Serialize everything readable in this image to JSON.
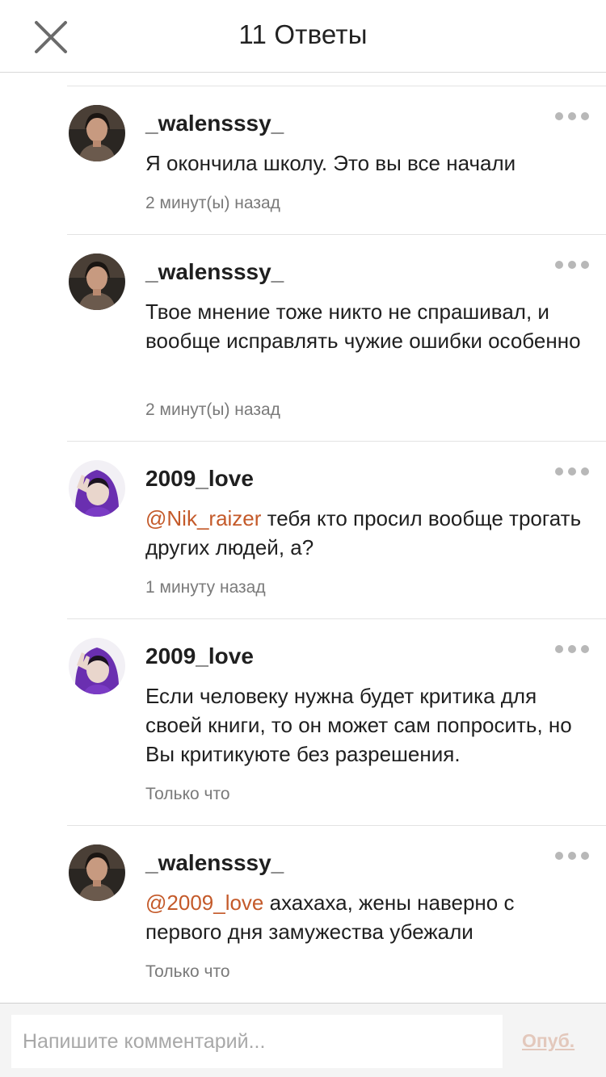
{
  "header": {
    "title": "11 Ответы",
    "close_icon": "close-icon"
  },
  "comments": [
    {
      "username": "_walensssy_",
      "avatar": "avatar-walensssy",
      "mention": "",
      "text": "Я окончила школу. Это вы все начали",
      "time": "2 минут(ы) назад"
    },
    {
      "username": "_walensssy_",
      "avatar": "avatar-walensssy",
      "mention": "",
      "text": "Твое мнение тоже никто не спрашивал, и вообще исправлять чужие ошибки особенно",
      "time": "2 минут(ы) назад"
    },
    {
      "username": "2009_love",
      "avatar": "avatar-2009-love",
      "mention": "@Nik_raizer",
      "text": " тебя кто просил вообще трогать других людей, а?",
      "time": "1 минуту назад"
    },
    {
      "username": "2009_love",
      "avatar": "avatar-2009-love",
      "mention": "",
      "text": "Если человеку нужна будет критика для своей книги, то он может сам попросить, но Вы критикуюте без разрешения.",
      "time": "Только что"
    },
    {
      "username": "_walensssy_",
      "avatar": "avatar-walensssy",
      "mention": "@2009_love",
      "text": " ахахаха, жены наверно с первого дня замужества убежали",
      "time": "Только что"
    }
  ],
  "footer": {
    "input_placeholder": "Напишите комментарий...",
    "publish_label": "Опуб."
  },
  "colors": {
    "mention": "#c45a2a",
    "publish_disabled": "#e3c8bc"
  }
}
